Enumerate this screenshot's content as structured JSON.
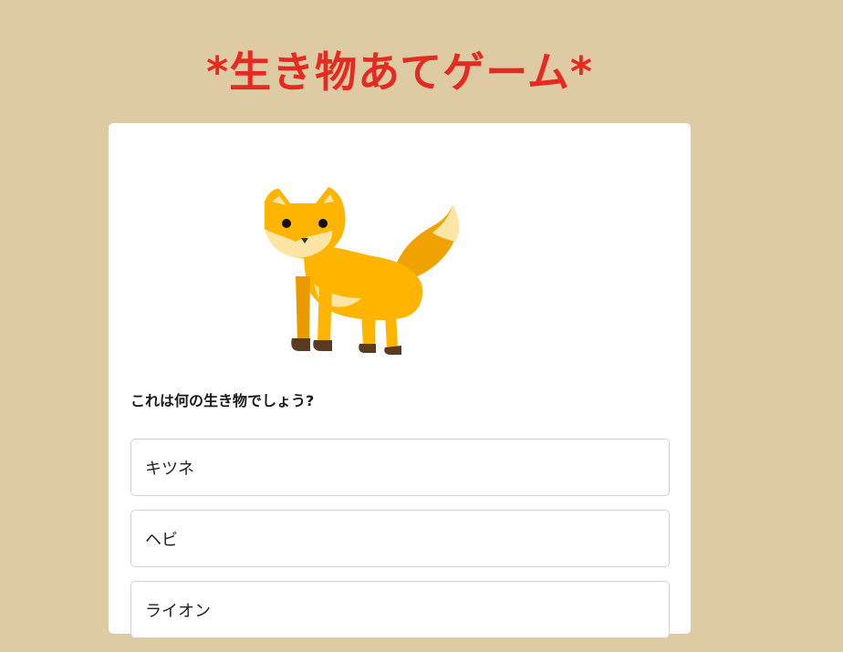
{
  "header": {
    "title": "*生き物あてゲーム*"
  },
  "quiz": {
    "image_icon": "fox-icon",
    "question": "これは何の生き物でしょう?",
    "options": [
      {
        "label": "キツネ"
      },
      {
        "label": "ヘビ"
      },
      {
        "label": "ライオン"
      }
    ]
  },
  "colors": {
    "background": "#dfcba3",
    "title": "#e52a22",
    "card": "#ffffff",
    "option_border": "#d2d2d2"
  }
}
